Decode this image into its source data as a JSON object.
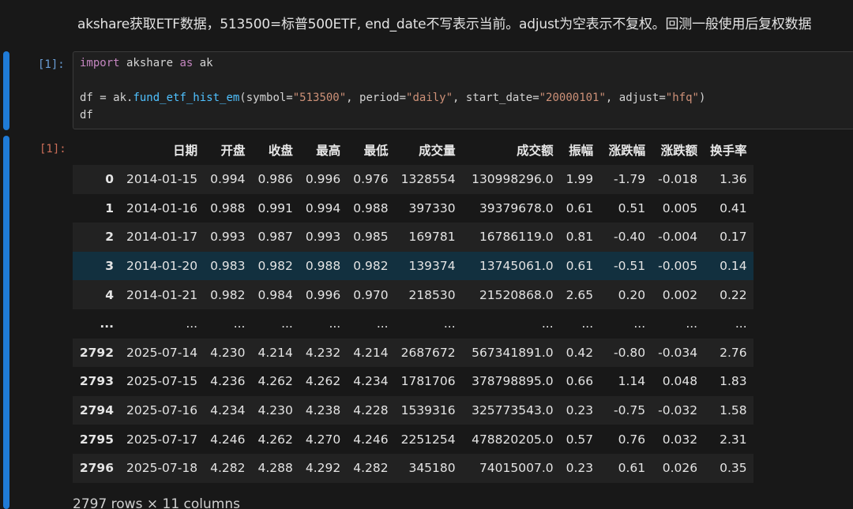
{
  "markdown": {
    "text": "akshare获取ETF数据，513500=标普500ETF, end_date不写表示当前。adjust为空表示不复权。回测一般使用后复权数据"
  },
  "code_cell": {
    "prompt": "[1]:",
    "lines": [
      [
        {
          "t": "import",
          "c": "kw"
        },
        {
          "t": " akshare ",
          "c": "op"
        },
        {
          "t": "as",
          "c": "kw"
        },
        {
          "t": " ak",
          "c": "op"
        }
      ],
      [],
      [
        {
          "t": "df = ak.",
          "c": "op"
        },
        {
          "t": "fund_etf_hist_em",
          "c": "call"
        },
        {
          "t": "(symbol=",
          "c": "op"
        },
        {
          "t": "\"513500\"",
          "c": "str"
        },
        {
          "t": ", period=",
          "c": "op"
        },
        {
          "t": "\"daily\"",
          "c": "str"
        },
        {
          "t": ", start_date=",
          "c": "op"
        },
        {
          "t": "\"20000101\"",
          "c": "str"
        },
        {
          "t": ", adjust=",
          "c": "op"
        },
        {
          "t": "\"hfq\"",
          "c": "str"
        },
        {
          "t": ")",
          "c": "op"
        }
      ],
      [
        {
          "t": "df",
          "c": "op"
        }
      ]
    ]
  },
  "output_cell": {
    "prompt": "[1]:",
    "columns": [
      "",
      "日期",
      "开盘",
      "收盘",
      "最高",
      "最低",
      "成交量",
      "成交额",
      "振幅",
      "涨跌幅",
      "涨跌额",
      "换手率"
    ],
    "rows": [
      [
        "0",
        "2014-01-15",
        "0.994",
        "0.986",
        "0.996",
        "0.976",
        "1328554",
        "130998296.0",
        "1.99",
        "-1.79",
        "-0.018",
        "1.36"
      ],
      [
        "1",
        "2014-01-16",
        "0.988",
        "0.991",
        "0.994",
        "0.988",
        "397330",
        "39379678.0",
        "0.61",
        "0.51",
        "0.005",
        "0.41"
      ],
      [
        "2",
        "2014-01-17",
        "0.993",
        "0.987",
        "0.993",
        "0.985",
        "169781",
        "16786119.0",
        "0.81",
        "-0.40",
        "-0.004",
        "0.17"
      ],
      [
        "3",
        "2014-01-20",
        "0.983",
        "0.982",
        "0.988",
        "0.982",
        "139374",
        "13745061.0",
        "0.61",
        "-0.51",
        "-0.005",
        "0.14"
      ],
      [
        "4",
        "2014-01-21",
        "0.982",
        "0.984",
        "0.996",
        "0.970",
        "218530",
        "21520868.0",
        "2.65",
        "0.20",
        "0.002",
        "0.22"
      ],
      [
        "...",
        "...",
        "...",
        "...",
        "...",
        "...",
        "...",
        "...",
        "...",
        "...",
        "...",
        "..."
      ],
      [
        "2792",
        "2025-07-14",
        "4.230",
        "4.214",
        "4.232",
        "4.214",
        "2687672",
        "567341891.0",
        "0.42",
        "-0.80",
        "-0.034",
        "2.76"
      ],
      [
        "2793",
        "2025-07-15",
        "4.236",
        "4.262",
        "4.262",
        "4.234",
        "1781706",
        "378798895.0",
        "0.66",
        "1.14",
        "0.048",
        "1.83"
      ],
      [
        "2794",
        "2025-07-16",
        "4.234",
        "4.230",
        "4.238",
        "4.228",
        "1539316",
        "325773543.0",
        "0.23",
        "-0.75",
        "-0.032",
        "1.58"
      ],
      [
        "2795",
        "2025-07-17",
        "4.246",
        "4.262",
        "4.270",
        "4.246",
        "2251254",
        "478820205.0",
        "0.57",
        "0.76",
        "0.032",
        "2.31"
      ],
      [
        "2796",
        "2025-07-18",
        "4.282",
        "4.288",
        "4.292",
        "4.282",
        "345180",
        "74015007.0",
        "0.23",
        "0.61",
        "0.026",
        "0.35"
      ]
    ],
    "hover_row_index": 3,
    "footer": "2797 rows × 11 columns"
  },
  "colors": {
    "background": "#181818",
    "cell_accent": "#1f7bd7",
    "hover_row": "#12303f"
  }
}
